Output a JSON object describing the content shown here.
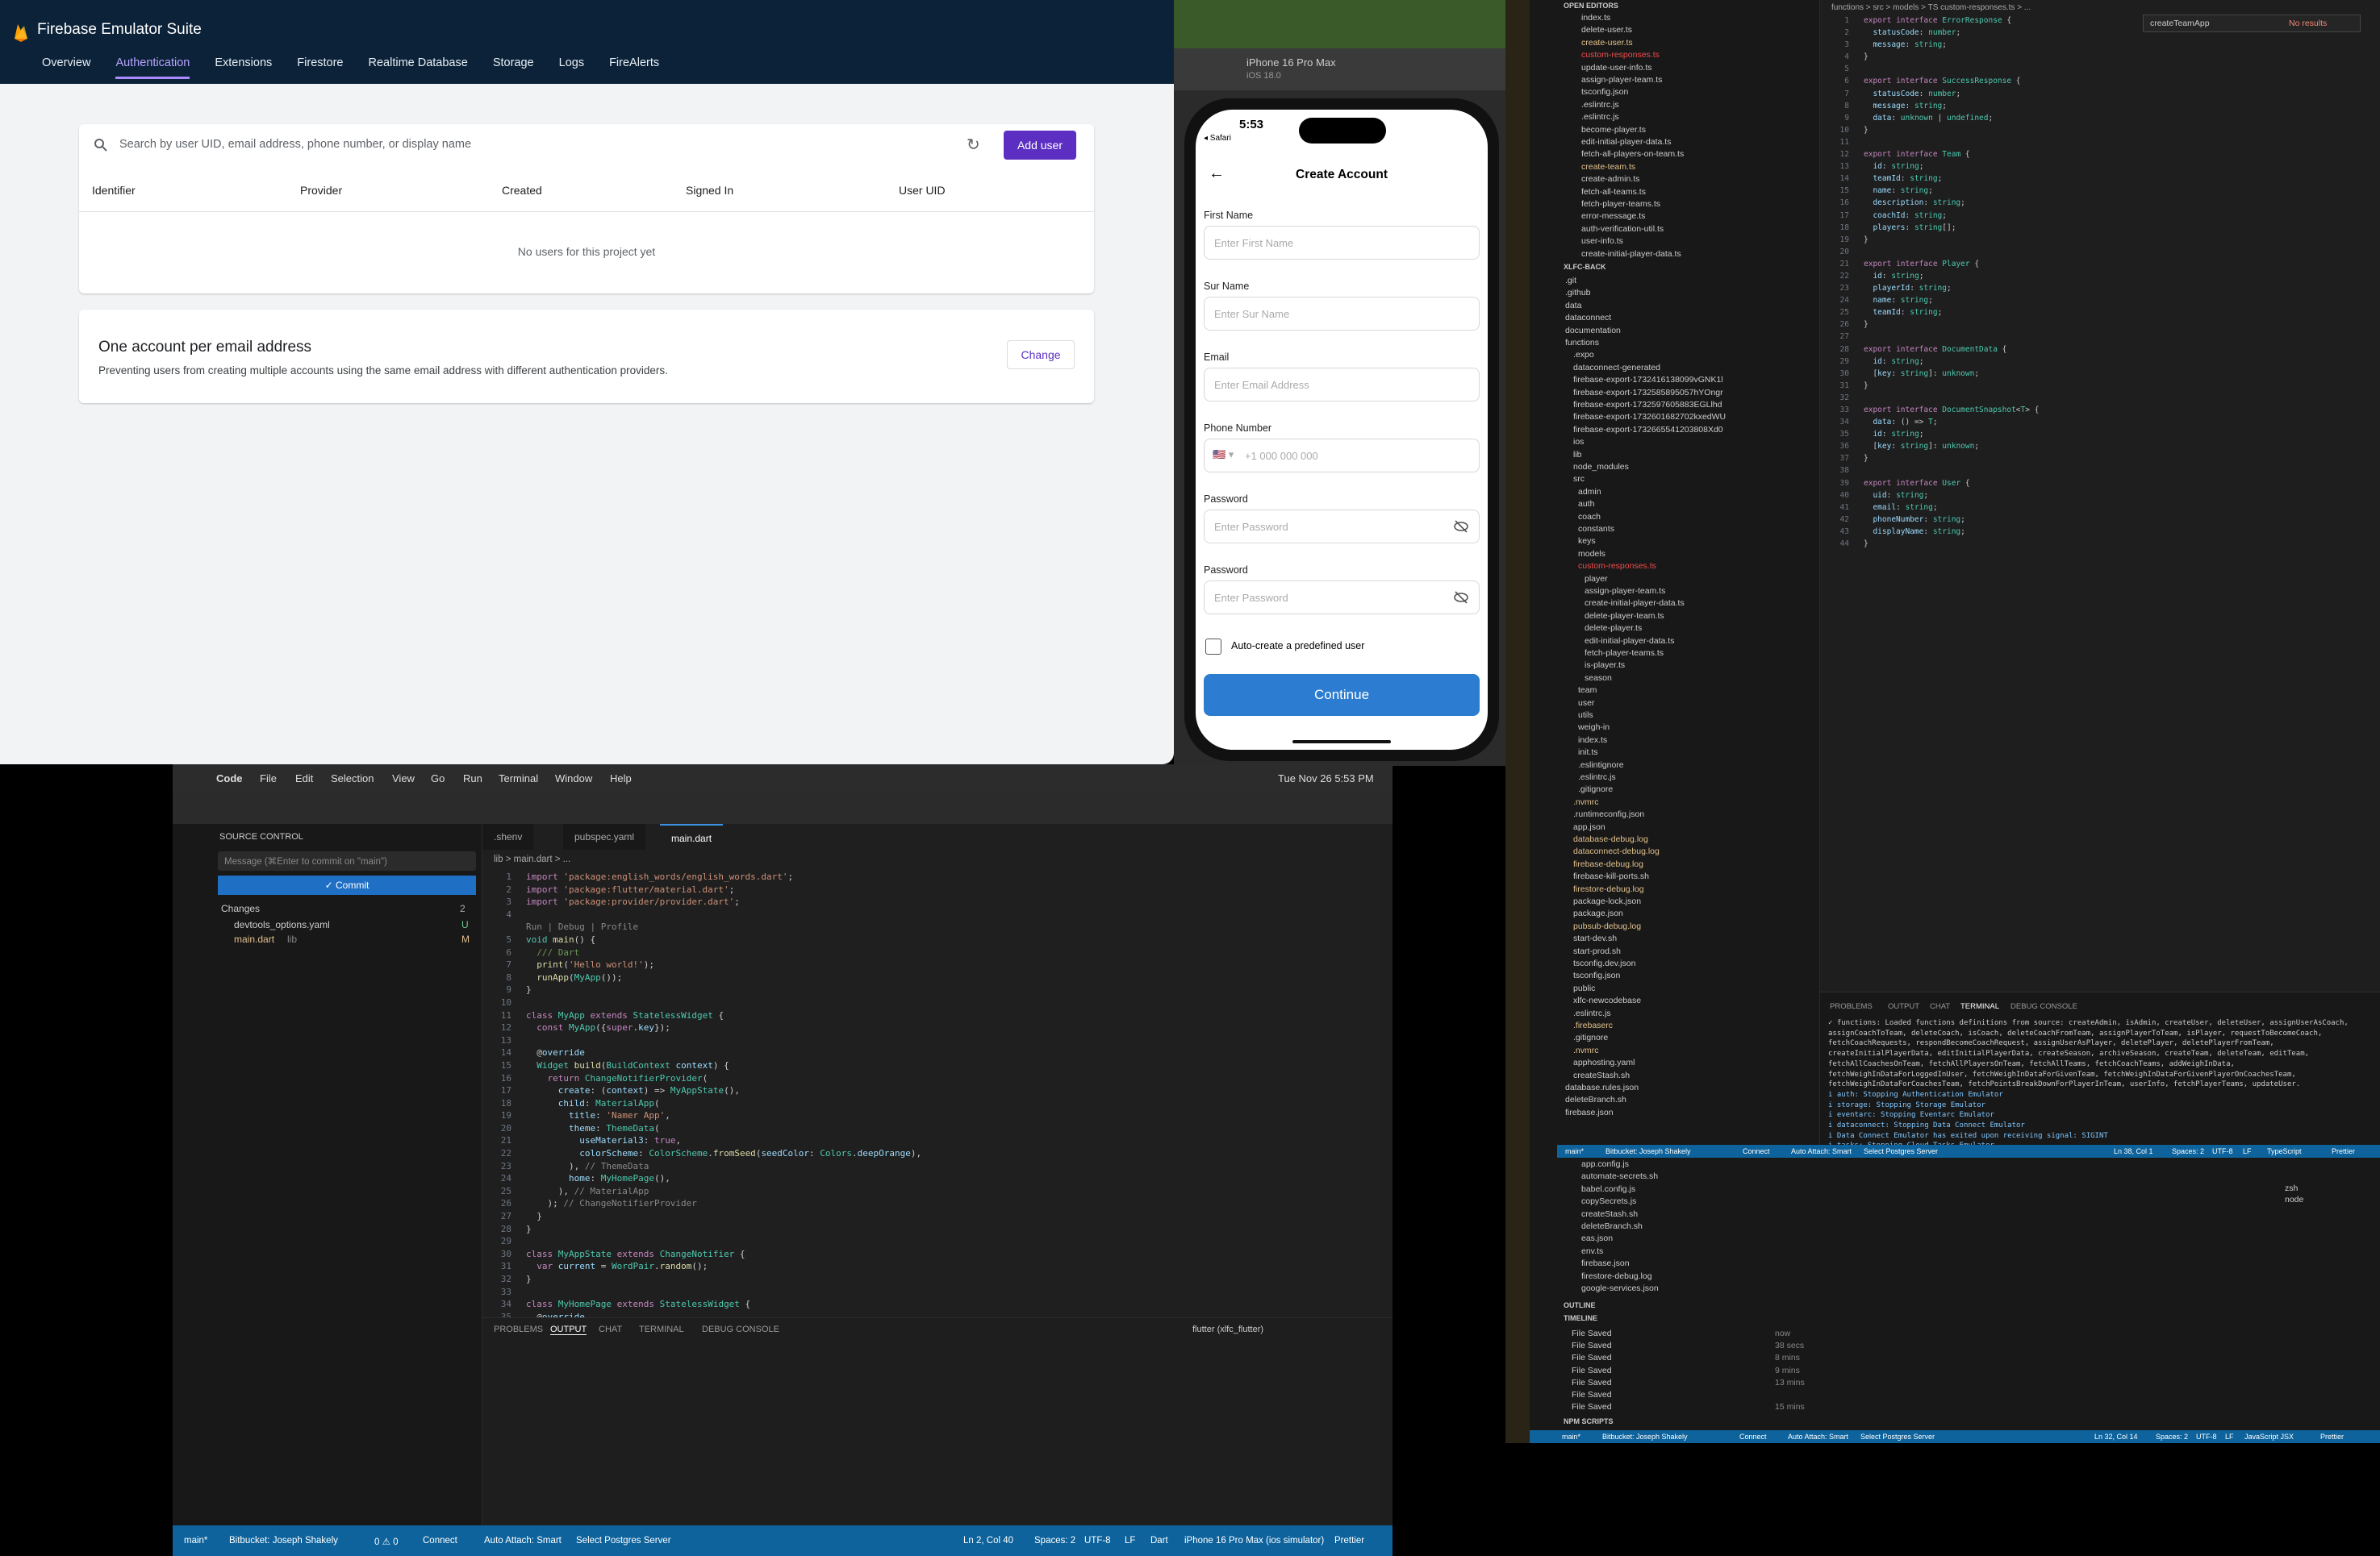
{
  "firebase": {
    "title": "Firebase Emulator Suite",
    "tabs": [
      "Overview",
      "Authentication",
      "Extensions",
      "Firestore",
      "Realtime Database",
      "Storage",
      "Logs",
      "FireAlerts"
    ],
    "active_tab": "Authentication",
    "search_placeholder": "Search by user UID, email address, phone number, or display name",
    "add_user": "Add user",
    "columns": [
      "Identifier",
      "Provider",
      "Created",
      "Signed In",
      "User UID"
    ],
    "empty": "No users for this project yet",
    "acct_title": "One account per email address",
    "acct_desc": "Preventing users from creating multiple accounts using the same email address with different authentication providers.",
    "change": "Change"
  },
  "simulator": {
    "device": "iPhone 16 Pro Max",
    "os": "iOS 18.0",
    "time": "5:53",
    "back_app": "◂ Safari",
    "header": "Create Account",
    "fields": [
      {
        "label": "First Name",
        "placeholder": "Enter First Name"
      },
      {
        "label": "Sur Name",
        "placeholder": "Enter Sur Name"
      },
      {
        "label": "Email",
        "placeholder": "Enter Email Address"
      },
      {
        "label": "Phone Number",
        "placeholder": "+1 000 000 000"
      },
      {
        "label": "Password",
        "placeholder": "Enter Password"
      },
      {
        "label": "Password",
        "placeholder": "Enter Password"
      }
    ],
    "checkbox": "Auto-create a predefined user",
    "continue": "Continue"
  },
  "vscode_bottom": {
    "menu": [
      "Code",
      "File",
      "Edit",
      "Selection",
      "View",
      "Go",
      "Run",
      "Terminal",
      "Window",
      "Help"
    ],
    "datetime": "Tue Nov 26  5:53 PM",
    "search": "xlfc_flutter",
    "source_control": "SOURCE CONTROL",
    "commit_placeholder": "Message (⌘Enter to commit on \"main\")",
    "commit": "✓ Commit",
    "changes": "Changes",
    "changes_count": "2",
    "files": [
      {
        "name": "devtools_options.yaml",
        "status": "U"
      },
      {
        "name": "main.dart",
        "path": "lib",
        "status": "M"
      }
    ],
    "tabs": [
      ".shenv",
      "pubspec.yaml",
      "main.dart"
    ],
    "breadcrumb": "lib > main.dart > ...",
    "panel_tabs": [
      "PROBLEMS",
      "OUTPUT",
      "CHAT",
      "TERMINAL",
      "DEBUG CONSOLE"
    ],
    "panel_select": "flutter (xlfc_flutter)",
    "status": [
      "main*",
      "Bitbucket: Joseph Shakely",
      "0 ⚠ 0",
      "Connect",
      "Auto Attach: Smart",
      "Select Postgres Server",
      "Ln 2, Col 40",
      "Spaces: 2",
      "UTF-8",
      "LF",
      "Dart",
      "iPhone 16 Pro Max (ios simulator)",
      "Prettier"
    ]
  },
  "vscode_right": {
    "breadcrumb": "functions > src > models > TS custom-responses.ts > ...",
    "find": "createTeamApp",
    "find_result": "No results",
    "open_editors_title": "OPEN EDITORS",
    "open_editors": [
      "index.ts",
      "delete-user.ts",
      "create-user.ts",
      "custom-responses.ts",
      "update-user-info.ts",
      "assign-player-team.ts",
      "tsconfig.json",
      ".eslintrc.js",
      ".eslintrc.js",
      "become-player.ts",
      "edit-initial-player-data.ts",
      "fetch-all-players-on-team.ts",
      "create-team.ts",
      "create-admin.ts",
      "fetch-all-teams.ts",
      "fetch-player-teams.ts",
      "error-message.ts",
      "auth-verification-util.ts",
      "user-info.ts",
      "create-initial-player-data.ts"
    ],
    "project": "XLFC-BACK",
    "tree": [
      ".git",
      ".github",
      "data",
      "dataconnect",
      "documentation",
      "functions",
      ".expo",
      "dataconnect-generated",
      "firebase-export-1732416138099vGNK1l",
      "firebase-export-1732585895057hYOngr",
      "firebase-export-1732597605883EGLlhd",
      "firebase-export-1732601682702kxedWU",
      "firebase-export-1732665541203808Xd0",
      "ios",
      "lib",
      "node_modules",
      "src",
      "admin",
      "auth",
      "coach",
      "constants",
      "keys",
      "models",
      "custom-responses.ts",
      "player",
      "assign-player-team.ts",
      "create-initial-player-data.ts",
      "delete-player-team.ts",
      "delete-player.ts",
      "edit-initial-player-data.ts",
      "fetch-player-teams.ts",
      "is-player.ts",
      "season",
      "team",
      "user",
      "utils",
      "weigh-in",
      "index.ts",
      "init.ts",
      ".eslintignore",
      ".eslintrc.js",
      ".gitignore",
      ".nvmrc",
      ".runtimeconfig.json",
      "app.json",
      "database-debug.log",
      "dataconnect-debug.log",
      "firebase-debug.log",
      "firebase-kill-ports.sh",
      "firestore-debug.log",
      "package-lock.json",
      "package.json",
      "pubsub-debug.log",
      "start-dev.sh",
      "start-prod.sh",
      "tsconfig.dev.json",
      "tsconfig.json",
      "public",
      "xlfc-newcodebase",
      ".eslintrc.js",
      ".firebaserc",
      ".gitignore",
      ".nvmrc",
      "apphosting.yaml",
      "createStash.sh",
      "database.rules.json",
      "deleteBranch.sh",
      "firebase.json"
    ],
    "outline": "OUTLINE",
    "timeline": "TIMELINE",
    "npm": "NPM SCRIPTS",
    "term_tabs": [
      "PROBLEMS",
      "OUTPUT",
      "CHAT",
      "TERMINAL",
      "DEBUG CONSOLE"
    ],
    "terminal": [
      "✓ functions: Loaded functions definitions from source: createAdmin, isAdmin, createUser, deleteUser, assignUserAsCoach, assignCoachToTeam, deleteCoach, isCoach, deleteCoachFromTeam, assignPlayerToTeam, isPlayer, requestToBecomeCoach, fetchCoachRequests, respondBecomeCoachRequest, assignUserAsPlayer, deletePlayer, deletePlayerFromTeam, createInitialPlayerData, editInitialPlayerData, createSeason, archiveSeason, createTeam, deleteTeam, editTeam, fetchAllCoachesOnTeam, fetchAllPlayersOnTeam, fetchAllTeams, fetchCoachTeams, addWeighInData, fetchWeighInDataForLoggedInUser, fetchWeighInDataForGivenTeam, fetchWeighInDataForGivenPlayerOnCoachesTeam, fetchWeighInDataForCoachesTeam, fetchPointsBreakDownForPlayerInTeam, userInfo, fetchPlayerTeams, updateUser.",
      "i  auth: Stopping Authentication Emulator",
      "i  storage: Stopping Storage Emulator",
      "i  eventarc: Stopping Eventarc Emulator",
      "i  dataconnect: Stopping Data Connect Emulator",
      "i  Data Connect Emulator has exited upon receiving signal: SIGINT",
      "i  tasks: Stopping Cloud Tasks Emulator",
      "i  hub: Stopping emulator hub",
      "i  logging: Stopping Logging Emulator"
    ],
    "status": [
      "main*",
      "Bitbucket: Joseph Shakely",
      "Connect",
      "Auto Attach: Smart",
      "Select Postgres Server",
      "Ln 38, Col 1",
      "Spaces: 2",
      "UTF-8",
      "LF",
      "TypeScript",
      "Prettier"
    ],
    "lower_files": [
      "app.config.js",
      "automate-secrets.sh",
      "babel.config.js",
      "copySecrets.js",
      "createStash.sh",
      "deleteBranch.sh",
      "eas.json",
      "env.ts",
      "firebase.json",
      "firestore-debug.log",
      "google-services.json"
    ],
    "timeline_items": [
      {
        "t": "File Saved",
        "w": "now"
      },
      {
        "t": "File Saved",
        "w": "38 secs"
      },
      {
        "t": "File Saved",
        "w": "8 mins"
      },
      {
        "t": "File Saved",
        "w": "9 mins"
      },
      {
        "t": "File Saved",
        "w": "13 mins"
      },
      {
        "t": "File Saved",
        "w": ""
      },
      {
        "t": "File Saved",
        "w": "15 mins"
      }
    ],
    "lower_term": [
      "zsh",
      "node"
    ],
    "status2": [
      "main*",
      "Bitbucket: Joseph Shakely",
      "Connect",
      "Auto Attach: Smart",
      "Select Postgres Server",
      "Ln 32, Col 14",
      "Spaces: 2",
      "UTF-8",
      "LF",
      "JavaScript JSX",
      "Prettier"
    ]
  }
}
